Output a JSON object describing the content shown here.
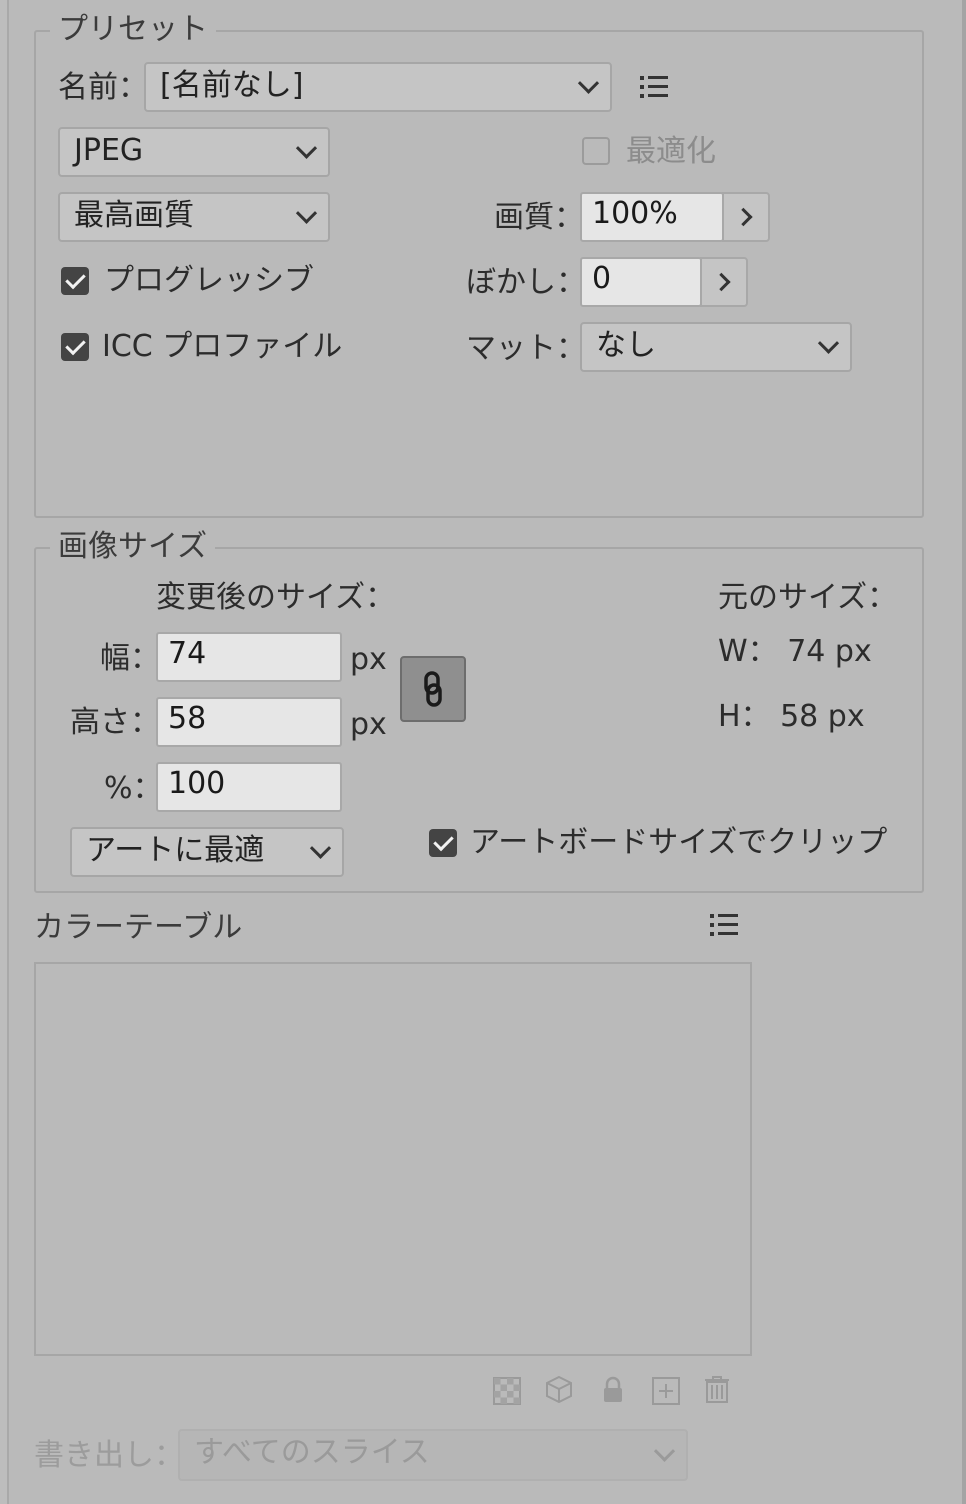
{
  "preset": {
    "legend": "プリセット",
    "name_label": "名前：",
    "name_value": "[名前なし]",
    "format_value": "JPEG",
    "optimize_label": "最適化",
    "quality_preset_value": "最高画質",
    "quality_label": "画質：",
    "quality_value": "100%",
    "progressive_label": "プログレッシブ",
    "blur_label": "ぼかし：",
    "blur_value": "0",
    "icc_label": "ICC プロファイル",
    "matte_label": "マット：",
    "matte_value": "なし"
  },
  "image_size": {
    "legend": "画像サイズ",
    "new_size_label": "変更後のサイズ：",
    "width_label": "幅：",
    "width_value": "74",
    "height_label": "高さ：",
    "height_value": "58",
    "percent_label": "%：",
    "percent_value": "100",
    "unit_w": "px",
    "unit_h": "px",
    "original_label": "元のサイズ：",
    "original_w": "W： 74 px",
    "original_h": "H：  58 px",
    "fit_value": "アートに最適",
    "clip_label": "アートボードサイズでクリップ"
  },
  "color_table": {
    "title": "カラーテーブル"
  },
  "export": {
    "label": "書き出し：",
    "value": "すべてのスライス"
  },
  "icons": [
    "list-menu-icon",
    "link-icon",
    "transparency-icon",
    "cube-icon",
    "lock-icon",
    "add-icon",
    "trash-icon"
  ]
}
